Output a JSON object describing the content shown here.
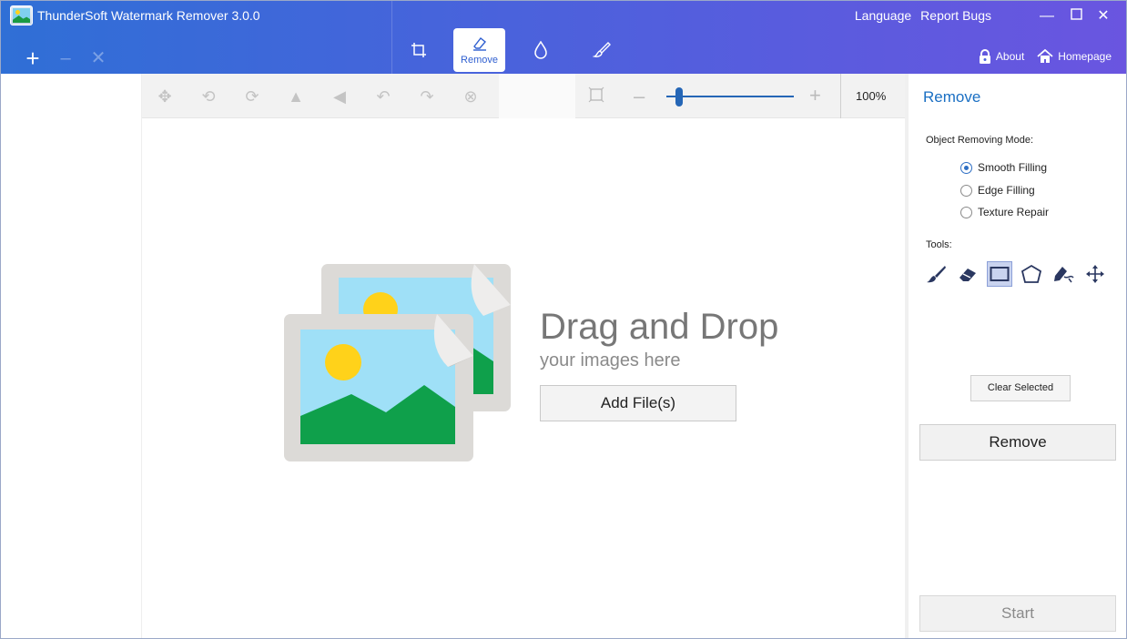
{
  "app": {
    "title": "ThunderSoft Watermark Remover 3.0.0"
  },
  "header": {
    "links": {
      "language": "Language",
      "report_bugs": "Report Bugs"
    },
    "tabs": {
      "remove_label": "Remove"
    },
    "right": {
      "about": "About",
      "homepage": "Homepage"
    },
    "accent_color": "#2f6fd6"
  },
  "toolbar": {
    "zoom_text": "100%",
    "zoom_level": 0.1
  },
  "canvas": {
    "drop_title": "Drag and Drop",
    "drop_subtitle": "your images here",
    "add_files_label": "Add File(s)"
  },
  "panel": {
    "title": "Remove",
    "mode_label": "Object Removing Mode:",
    "modes": [
      {
        "label": "Smooth Filling",
        "selected": true
      },
      {
        "label": "Edge Filling",
        "selected": false
      },
      {
        "label": "Texture Repair",
        "selected": false
      }
    ],
    "tools_label": "Tools:",
    "tools": [
      "brush-icon",
      "eraser-icon",
      "rectangle-select-icon",
      "polygon-select-icon",
      "pen-select-icon",
      "move-icon"
    ],
    "selected_tool": "rectangle-select-icon",
    "clear_selected_label": "Clear Selected",
    "remove_label": "Remove",
    "start_label": "Start"
  }
}
